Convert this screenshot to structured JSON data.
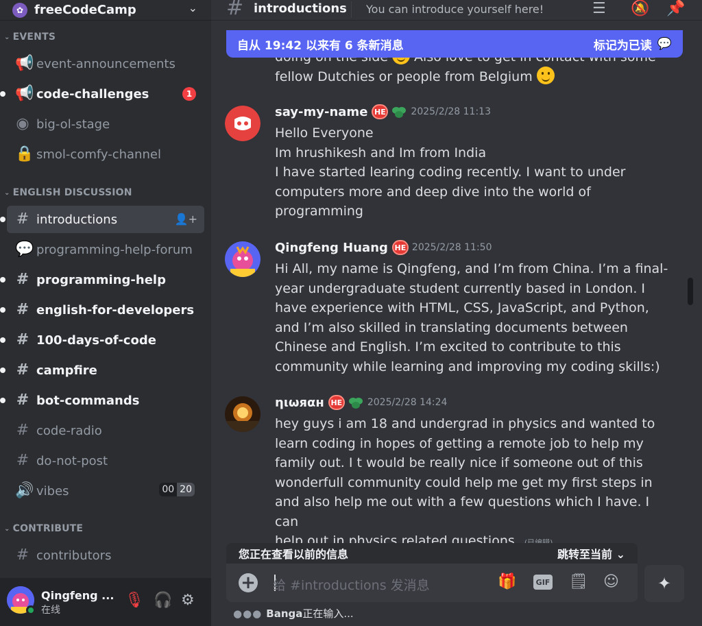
{
  "server": {
    "name": "freeCodeCamp"
  },
  "sidebar": {
    "categories": {
      "events": "EVENTS",
      "english": "ENGLISH DISCUSSION",
      "contribute": "CONTRIBUTE"
    },
    "channels": [
      {
        "name": "event-announcements",
        "icon": "megaphone-icon"
      },
      {
        "name": "code-challenges",
        "icon": "megaphone-icon",
        "badge": "1"
      },
      {
        "name": "big-ol-stage",
        "icon": "stage-icon"
      },
      {
        "name": "smol-comfy-channel",
        "icon": "lock-icon"
      },
      {
        "name": "introductions",
        "icon": "hash-icon"
      },
      {
        "name": "programming-help-forum",
        "icon": "forum-icon"
      },
      {
        "name": "programming-help",
        "icon": "hash-icon"
      },
      {
        "name": "english-for-developers",
        "icon": "hash-icon"
      },
      {
        "name": "100-days-of-code",
        "icon": "hash-icon"
      },
      {
        "name": "campfire",
        "icon": "hash-icon"
      },
      {
        "name": "bot-commands",
        "icon": "hash-icon"
      },
      {
        "name": "code-radio",
        "icon": "hash-icon"
      },
      {
        "name": "do-not-post",
        "icon": "hash-icon"
      },
      {
        "name": "vibes",
        "icon": "speaker-icon",
        "count_a": "00",
        "count_b": "20"
      },
      {
        "name": "contributors",
        "icon": "hash-icon"
      }
    ]
  },
  "user": {
    "name": "Qingfeng ...",
    "status": "在线"
  },
  "channel": {
    "name": "introductions",
    "topic": "You can introduce yourself here!"
  },
  "banner": {
    "text": "自从 19:42 以来有 6 条新消息",
    "action": "标记为已读"
  },
  "partial_message": {
    "line1": "doing on the side",
    "line1b": " Also love to get in contact with some",
    "line2": "fellow Dutchies or people from Belgium "
  },
  "messages": [
    {
      "author": "say-my-name",
      "time": "2025/2/28 11:13",
      "lines": [
        "Hello Everyone",
        "Im hrushikesh and Im from India",
        "I have started learing coding recently. I want to under",
        "computers more and deep dive into the world of",
        "programming"
      ]
    },
    {
      "author": "Qingfeng Huang",
      "time": "2025/2/28 11:50",
      "lines": [
        "Hi All, my name is Qingfeng, and I’m from China. I’m a final-",
        "year undergraduate student currently based in London. I",
        "have experience with HTML, CSS, JavaScript, and Python,",
        "and I’m also skilled in translating documents between",
        "Chinese and English. I’m excited to contribute to this",
        "community while learning and improving my coding skills:)"
      ]
    },
    {
      "author": "ηιωяαн",
      "time": "2025/2/28 14:24",
      "lines": [
        "hey guys i am 18 and undergrad in physics and wanted to",
        "learn coding in hopes of getting a remote job to help my",
        "family out. I t would be really nice if someone out of this",
        "wonderfull community could help me get my first steps in",
        "and also help me out with a few questions which I have. I can",
        "help out in physics related questions."
      ],
      "edited": "(已编辑)"
    }
  ],
  "role_badge": "HE",
  "older_bar": {
    "left": "您正在查看以前的信息",
    "right": "跳转至当前"
  },
  "composer": {
    "placeholder": "给 #introductions 发消息",
    "gif": "GIF"
  },
  "typing": {
    "name": "Banga",
    "text": "正在输入..."
  },
  "colors": {
    "accent": "#5865f2",
    "bg": "#313338",
    "sidebar": "#2b2d31",
    "unread_badge": "#f23f43"
  }
}
